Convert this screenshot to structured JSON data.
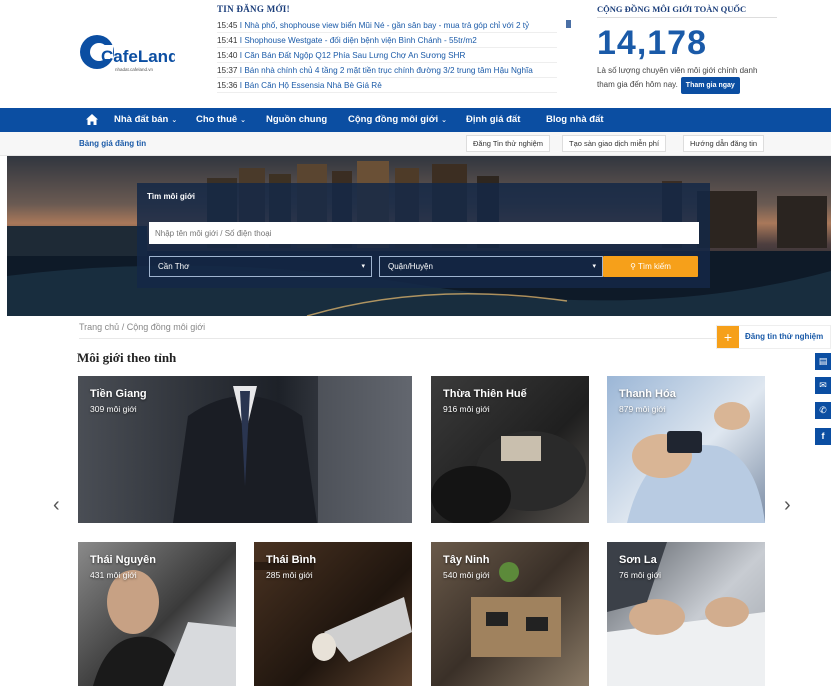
{
  "logo": {
    "name": "CafeLand",
    "sub": "nhadat.cafeland.vn"
  },
  "news": {
    "title": "TIN ĐĂNG MỚI!",
    "items": [
      {
        "time": "15:45",
        "text": "Nhà phố, shophouse view biển Mũi Né - gần sân bay - mua trả góp chỉ với 2 tỷ"
      },
      {
        "time": "15:41",
        "text": "Shophouse Westgate - đối diện bệnh viện Bình Chánh - 55tr/m2"
      },
      {
        "time": "15:40",
        "text": "Căn Bán Đất Ngộp Q12 Phía Sau Lưng Chợ An Sương SHR"
      },
      {
        "time": "15:37",
        "text": "Bán nhà chính chủ 4 tầng 2 mặt tiền trục chính đường 3/2 trung tâm Hậu Nghĩa"
      },
      {
        "time": "15:36",
        "text": "Bán Căn Hộ Essensia Nhà Bè Giá Rẻ"
      }
    ]
  },
  "community": {
    "title": "CỘNG ĐỒNG MÔI GIỚI TOÀN QUỐC",
    "count": "14,178",
    "desc": "Là số lượng chuyên viên môi giới chính danh tham gia đến hôm nay.",
    "join": "Tham gia ngay"
  },
  "nav": {
    "home_icon": "home-icon",
    "items": [
      "Nhà đất bán",
      "Cho thuê",
      "Nguồn chung",
      "Cộng đồng môi giới",
      "Định giá đất",
      "Blog nhà đất"
    ]
  },
  "subbar": {
    "left": "Bảng giá đăng tin",
    "buttons": [
      "Đăng Tin thử nghiệm",
      "Tạo sàn giao dịch miễn phí",
      "Hướng dẫn đăng tin"
    ]
  },
  "search": {
    "label": "Tìm môi giới",
    "placeholder": "Nhập tên môi giới / Số điện thoại",
    "city": "Cần Thơ",
    "district": "Quận/Huyện",
    "button": "Tìm kiếm"
  },
  "breadcrumb": "Trang chủ / Cộng đồng môi giới",
  "post_button": "Đăng tin thử nghiệm",
  "section_title": "Môi giới theo tỉnh",
  "cards": [
    {
      "province": "Tiền Giang",
      "count": "309 môi giới"
    },
    {
      "province": "Thừa Thiên Huế",
      "count": "916 môi giới"
    },
    {
      "province": "Thanh Hóa",
      "count": "879 môi giới"
    },
    {
      "province": "Thái Nguyên",
      "count": "431 môi giới"
    },
    {
      "province": "Thái Bình",
      "count": "285 môi giới"
    },
    {
      "province": "Tây Ninh",
      "count": "540 môi giới"
    },
    {
      "province": "Sơn La",
      "count": "76 môi giới"
    }
  ],
  "colors": {
    "brand": "#0b4ea2",
    "accent": "#f6a01a"
  }
}
